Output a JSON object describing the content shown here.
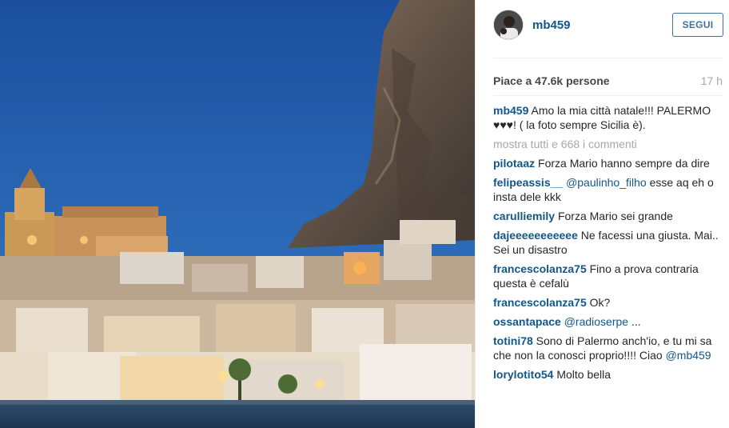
{
  "post": {
    "username": "mb459",
    "follow_label": "SEGUI",
    "likes_text": "Piace a 47.6k persone",
    "time_ago": "17 h",
    "caption": {
      "user": "mb459",
      "text": "Amo la mia città natale!!! PALERMO ♥♥♥! ( la foto sempre Sicilia è)."
    },
    "view_all_comments": "mostra tutti e 668 i commenti"
  },
  "comments": [
    {
      "user": "pilotaaz",
      "text": "Forza Mario hanno sempre da dire"
    },
    {
      "user": "felipeassis__",
      "mention": "@paulinho_filho",
      "text": "esse aq eh o insta dele kkk"
    },
    {
      "user": "carulliemily",
      "text": "Forza Mario sei grande"
    },
    {
      "user": "dajeeeeeeeeeee",
      "text": "Ne facessi una giusta. Mai.. Sei un disastro"
    },
    {
      "user": "francescolanza75",
      "text": "Fino a prova contraria questa è cefalù"
    },
    {
      "user": "francescolanza75",
      "text": "Ok?"
    },
    {
      "user": "ossantapace",
      "mention": "@radioserpe",
      "text": "..."
    },
    {
      "user": "totini78",
      "text": "Sono di Palermo anch'io, e tu mi sa che non la conosci proprio!!!! Ciao",
      "mention_after": "@mb459"
    },
    {
      "user": "lorylotito54",
      "text": "Molto bella"
    }
  ],
  "colors": {
    "link": "#125688",
    "follow": "#3f729b",
    "muted": "#a5a7aa"
  }
}
